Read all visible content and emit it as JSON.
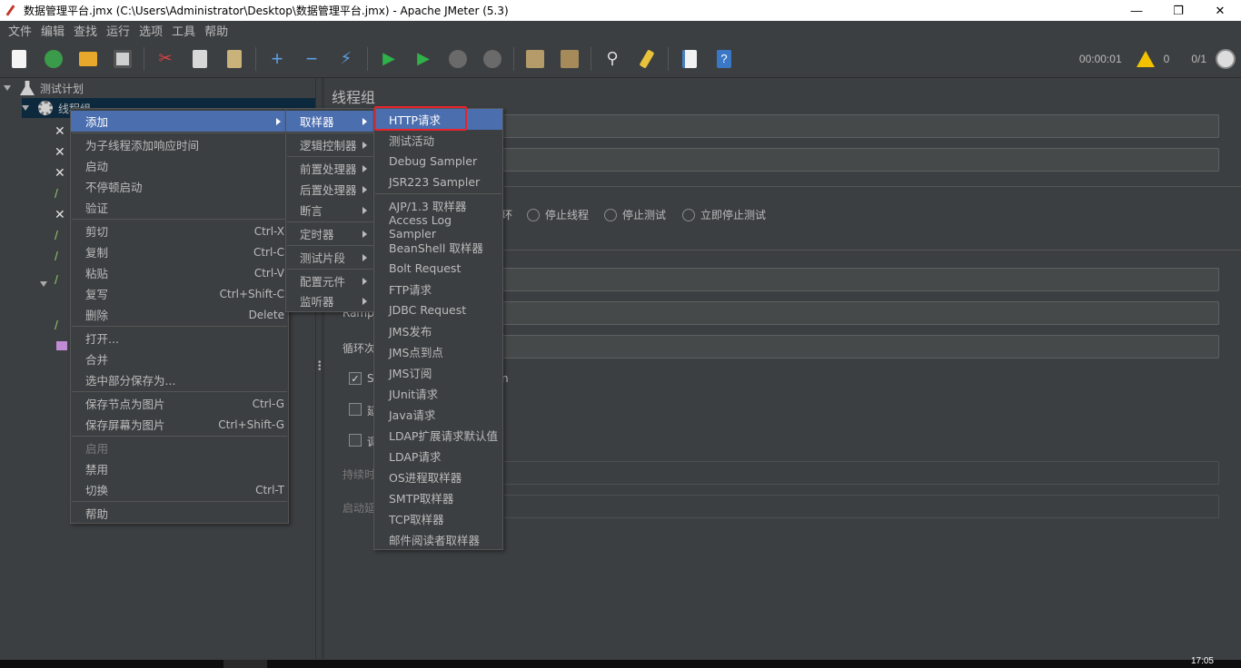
{
  "window": {
    "title": "数据管理平台.jmx (C:\\Users\\Administrator\\Desktop\\数据管理平台.jmx) - Apache JMeter (5.3)",
    "minimize": "—",
    "maximize": "❐",
    "close": "✕"
  },
  "menubar": [
    "文件",
    "编辑",
    "查找",
    "运行",
    "选项",
    "工具",
    "帮助"
  ],
  "toolbar": {
    "buttons": [
      "new-icon",
      "templates-icon",
      "open-icon",
      "save-icon",
      "cut-icon",
      "copy-icon",
      "paste-icon",
      "expand-icon",
      "collapse-icon",
      "toggle-icon",
      "start-icon",
      "start-no-pause-icon",
      "stop-icon",
      "shutdown-icon",
      "clear-icon",
      "clear-all-icon",
      "search-icon",
      "reset-search-icon",
      "function-helper-icon",
      "help-icon"
    ],
    "elapsed": "00:00:01",
    "warnings": "0",
    "threads": "0/1"
  },
  "tree": {
    "root": "测试计划",
    "thread_group": "线程组"
  },
  "panel": {
    "heading": "线程组",
    "radio_continue_tail": "环",
    "radio_stop_thread": "停止线程",
    "radio_stop_test": "停止测试",
    "radio_stop_now": "立即停止测试",
    "label_ramp": "Ramp",
    "label_loop": "循环次",
    "check1_label_head": "S",
    "check1_label_tail": "n",
    "check2_label": "延",
    "check3_label": "调",
    "label_duration": "持续时",
    "label_delay": "启动延"
  },
  "context_menu": {
    "items": [
      {
        "label": "添加",
        "accel": "",
        "submenu": true
      },
      {
        "label": "为子线程添加响应时间",
        "accel": ""
      },
      {
        "label": "启动",
        "accel": ""
      },
      {
        "label": "不停顿启动",
        "accel": ""
      },
      {
        "label": "验证",
        "accel": ""
      },
      {
        "label": "剪切",
        "accel": "Ctrl-X"
      },
      {
        "label": "复制",
        "accel": "Ctrl-C"
      },
      {
        "label": "粘贴",
        "accel": "Ctrl-V"
      },
      {
        "label": "复写",
        "accel": "Ctrl+Shift-C"
      },
      {
        "label": "删除",
        "accel": "Delete"
      },
      {
        "label": "打开...",
        "accel": ""
      },
      {
        "label": "合并",
        "accel": ""
      },
      {
        "label": "选中部分保存为...",
        "accel": ""
      },
      {
        "label": "保存节点为图片",
        "accel": "Ctrl-G"
      },
      {
        "label": "保存屏幕为图片",
        "accel": "Ctrl+Shift-G"
      },
      {
        "label": "启用",
        "accel": "",
        "disabled": true
      },
      {
        "label": "禁用",
        "accel": ""
      },
      {
        "label": "切换",
        "accel": "Ctrl-T"
      },
      {
        "label": "帮助",
        "accel": ""
      }
    ]
  },
  "add_submenu": {
    "items": [
      "取样器",
      "逻辑控制器",
      "前置处理器",
      "后置处理器",
      "断言",
      "定时器",
      "测试片段",
      "配置元件",
      "监听器"
    ]
  },
  "sampler_submenu": {
    "items": [
      "HTTP请求",
      "测试活动",
      "Debug Sampler",
      "JSR223 Sampler",
      "AJP/1.3 取样器",
      "Access Log Sampler",
      "BeanShell 取样器",
      "Bolt Request",
      "FTP请求",
      "JDBC Request",
      "JMS发布",
      "JMS点到点",
      "JMS订阅",
      "JUnit请求",
      "Java请求",
      "LDAP扩展请求默认值",
      "LDAP请求",
      "OS进程取样器",
      "SMTP取样器",
      "TCP取样器",
      "邮件阅读者取样器"
    ]
  },
  "taskbar": {
    "clock": "17:05"
  },
  "colors": {
    "background": "#3c3f41",
    "highlight": "#4b6eaf",
    "annotation": "#e8232a"
  }
}
